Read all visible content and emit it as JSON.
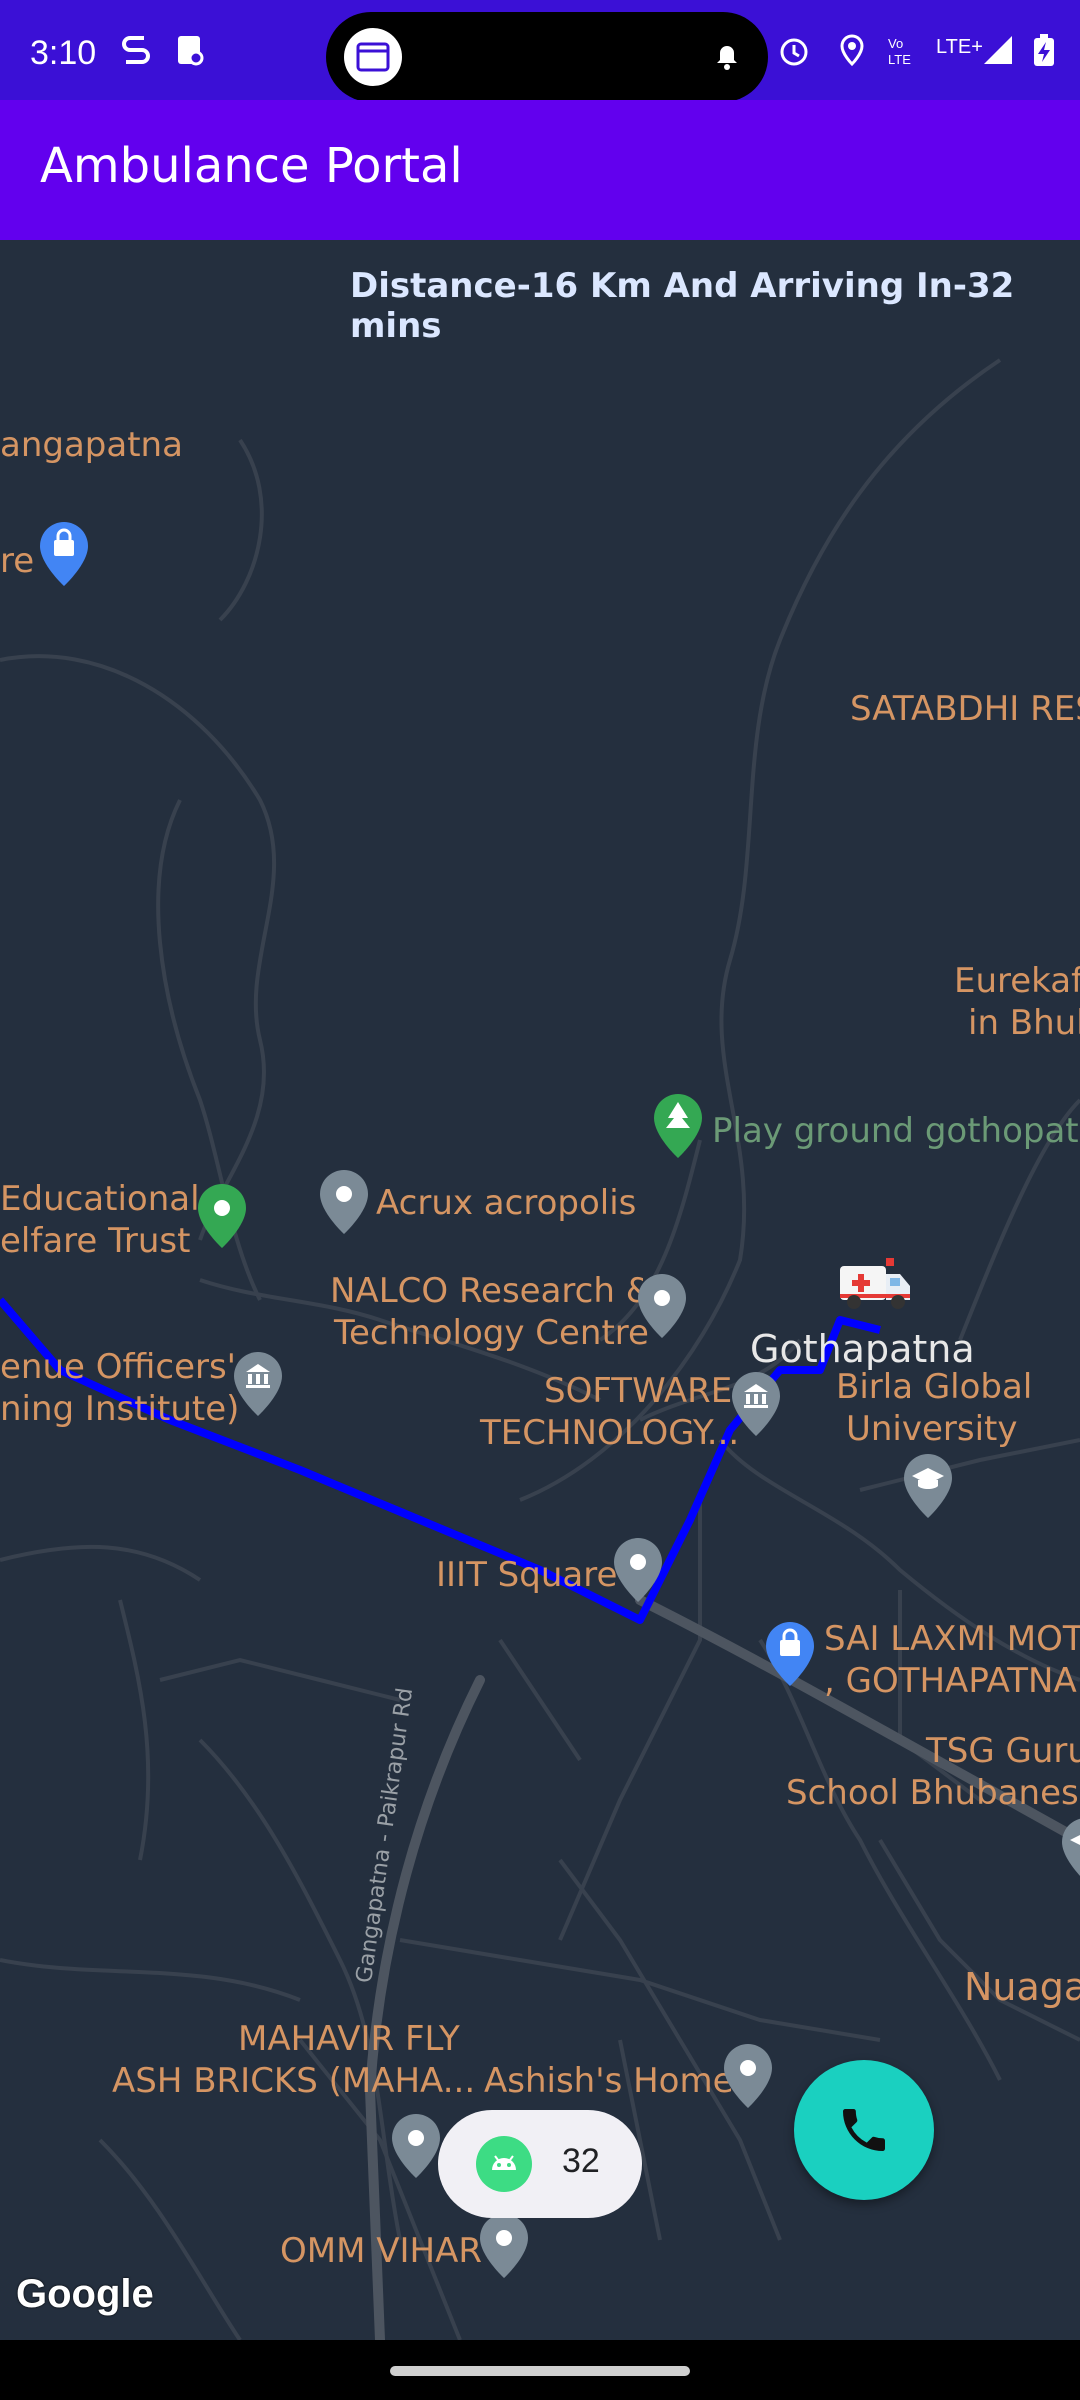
{
  "status_bar": {
    "time": "3:10",
    "network": "LTE+",
    "icons": [
      "notification-s-icon",
      "notification-clipboard-icon",
      "bell-icon",
      "alarm-icon",
      "location-icon",
      "volte-icon",
      "signal-icon",
      "battery-charging-icon"
    ]
  },
  "app_bar": {
    "title": "Ambulance Portal",
    "color": "#6200ee"
  },
  "map": {
    "info_text": "Distance-16 Km And Arriving In-32 mins",
    "route_color": "#0000ff",
    "places": {
      "gangapatna": "angapatna",
      "satabdhi": "SATABDHI RESO",
      "eurekafe_line1": "Eurekafe",
      "eurekafe_line2": "in Bhub",
      "playground": "Play ground gothopatan",
      "educational_line1": "Educational",
      "educational_line2": "elfare Trust",
      "acrux": "Acrux acropolis",
      "nalco_line1": "NALCO Research &",
      "nalco_line2": "Technology Centre",
      "revenue_line1": "enue Officers'",
      "revenue_line2": "ning Institute)",
      "gothapatna": "Gothapatna",
      "software_line1": "SOFTWARE",
      "software_line2": "TECHNOLOGY...",
      "birla_line1": "Birla Global",
      "birla_line2": "University",
      "iiit": "IIIT Square",
      "sai_line1": "SAI LAXMI MOTO",
      "sai_line2": ", GOTHAPATNA",
      "tsg_line1": "TSG Guruk",
      "tsg_line2": "School Bhubanesw",
      "nuaga": "Nuaga",
      "street": "Gangapatna - Paikrapur Rd",
      "mahavir_line1": "MAHAVIR FLY",
      "mahavir_line2": "ASH BRICKS (MAHA...",
      "ashish": "Ashish's Home",
      "omm": "OMM VIHAR",
      "store_partial": "re"
    },
    "attribution": "Google"
  },
  "chip": {
    "label": "32",
    "icon": "android-icon"
  },
  "fab": {
    "icon": "phone-icon",
    "color": "#1ad0c0"
  }
}
